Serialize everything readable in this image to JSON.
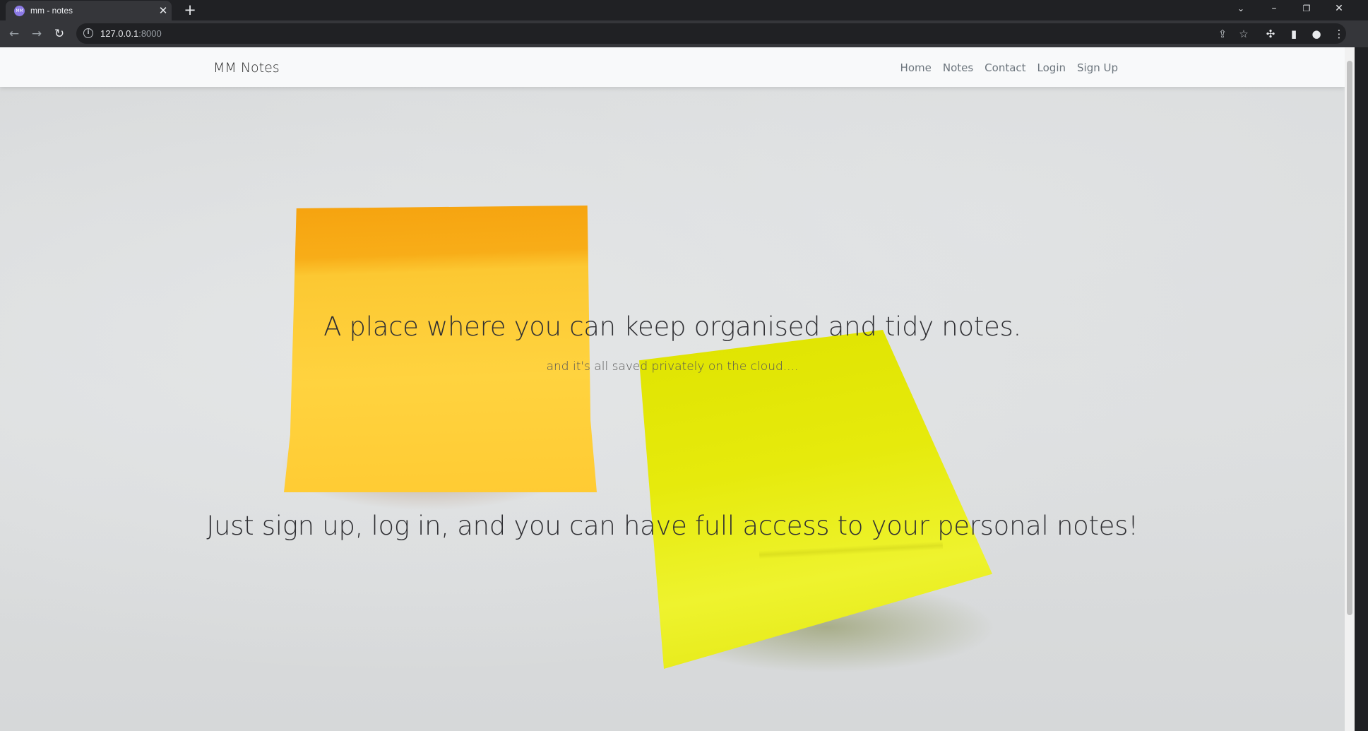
{
  "browser": {
    "tab_title": "mm - notes",
    "tab_favicon_text": "MM",
    "url_host": "127.0.0.1",
    "url_port": ":8000"
  },
  "icons": {
    "tab_close": "close-icon",
    "new_tab": "plus-icon",
    "back": "arrow-left-icon",
    "forward": "arrow-right-icon",
    "reload": "reload-icon",
    "site_info": "info-icon",
    "share": "share-icon",
    "bookmark": "star-icon",
    "extensions": "puzzle-icon",
    "side_panel": "side-panel-icon",
    "profile": "profile-icon",
    "menu": "kebab-menu-icon"
  },
  "navbar": {
    "brand": "MM Notes",
    "links": [
      "Home",
      "Notes",
      "Contact",
      "Login",
      "Sign Up"
    ]
  },
  "hero": {
    "headline": "A place where you can keep organised and tidy notes.",
    "subheadline": "and it's all saved privately on the cloud....",
    "cta_text": "Just sign up, log in, and you can have full access to your personal notes!"
  },
  "colors": {
    "navbar_bg": "#f8f9fa",
    "note_orange": "#ffd33f",
    "note_yellow_green": "#e6ea0c",
    "wall": "#d9dbdc"
  }
}
